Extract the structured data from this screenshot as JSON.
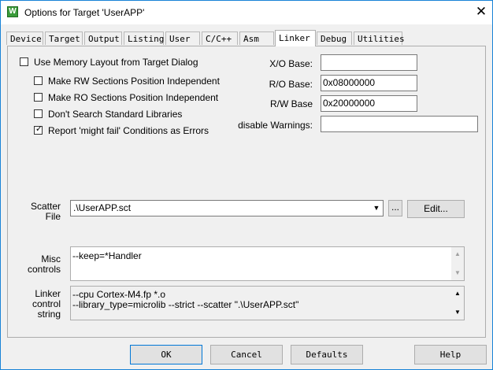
{
  "window": {
    "title": "Options for Target 'UserAPP'",
    "app_icon_glyph": "W",
    "close_glyph": "✕"
  },
  "tabs": [
    {
      "label": "Device"
    },
    {
      "label": "Target"
    },
    {
      "label": "Output"
    },
    {
      "label": "Listing"
    },
    {
      "label": "User"
    },
    {
      "label": "C/C++"
    },
    {
      "label": "Asm"
    },
    {
      "label": "Linker",
      "active": true
    },
    {
      "label": "Debug"
    },
    {
      "label": "Utilities"
    }
  ],
  "checkboxes": {
    "use_memory_layout": {
      "label": "Use Memory Layout from Target Dialog",
      "checked": false
    },
    "rw_position_independent": {
      "label": "Make RW Sections Position Independent",
      "checked": false
    },
    "ro_position_independent": {
      "label": "Make RO Sections Position Independent",
      "checked": false
    },
    "dont_search_std_libs": {
      "label": "Don't Search Standard Libraries",
      "checked": false
    },
    "might_fail_errors": {
      "label": "Report 'might fail' Conditions as Errors",
      "checked": true
    },
    "check_glyph": "✓"
  },
  "fields": {
    "xo_base": {
      "label": "X/O Base:",
      "value": ""
    },
    "ro_base": {
      "label": "R/O Base:",
      "value": "0x08000000"
    },
    "rw_base": {
      "label": "R/W Base",
      "value": "0x20000000"
    },
    "disable_warnings": {
      "label": "disable Warnings:",
      "value": ""
    }
  },
  "scatter": {
    "label_line1": "Scatter",
    "label_line2": "File",
    "value": ".\\UserAPP.sct",
    "browse_label": "...",
    "edit_label": "Edit..."
  },
  "misc": {
    "label_line1": "Misc",
    "label_line2": "controls",
    "value": "--keep=*Handler"
  },
  "linker_control": {
    "label_line1": "Linker",
    "label_line2": "control",
    "label_line3": "string",
    "line1": "--cpu Cortex-M4.fp *.o",
    "line2": "--library_type=microlib --strict --scatter \".\\UserAPP.sct\""
  },
  "buttons": {
    "ok": "OK",
    "cancel": "Cancel",
    "defaults": "Defaults",
    "help": "Help"
  },
  "icons": {
    "dropdown": "▼",
    "scroll_up": "▲",
    "scroll_down": "▼"
  }
}
